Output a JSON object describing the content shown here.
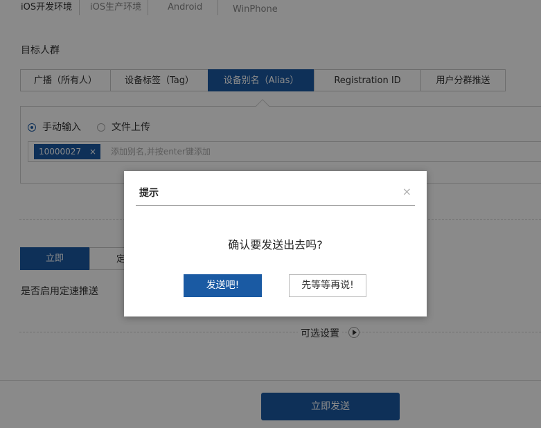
{
  "env_tabs": [
    "iOS开发环境",
    "iOS生产环境",
    "Android",
    "WinPhone"
  ],
  "section_title": "目标人群",
  "target_tabs": [
    {
      "label": "广播（所有人）",
      "active": false
    },
    {
      "label": "设备标签（Tag）",
      "active": false
    },
    {
      "label": "设备别名（Alias）",
      "active": true
    },
    {
      "label": "Registration ID",
      "active": false
    },
    {
      "label": "用户分群推送",
      "active": false
    }
  ],
  "input_mode": {
    "manual_label": "手动输入",
    "upload_label": "文件上传",
    "selected": "manual"
  },
  "alias_input": {
    "chips": [
      "10000027"
    ],
    "chip_remove": "×",
    "placeholder": "添加别名,并按enter键添加"
  },
  "send_time": {
    "options": [
      "立即",
      "定"
    ],
    "selected": "立即"
  },
  "speed_label": "是否启用定速推送",
  "optional_settings": "可选设置",
  "send_now_button": "立即发送",
  "colors": {
    "accent": "#1a5aa3"
  },
  "modal": {
    "title": "提示",
    "close_symbol": "×",
    "message": "确认要发送出去吗?",
    "confirm_button": "发送吧!",
    "later_button": "先等等再说!"
  }
}
